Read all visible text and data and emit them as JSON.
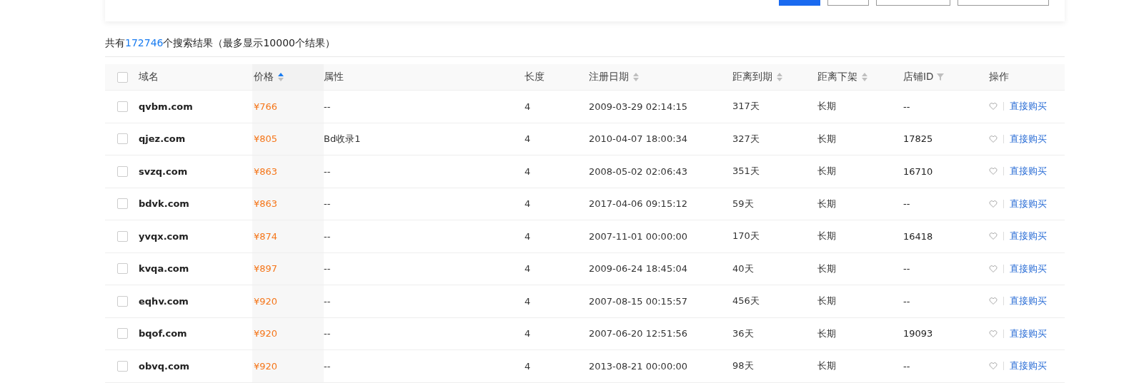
{
  "summary": {
    "before": "共有",
    "count": "172746",
    "after": "个搜索结果（最多显示10000个结果）"
  },
  "table": {
    "select_all_checked": false,
    "columns": [
      {
        "label": "域名",
        "kind": "plain"
      },
      {
        "label": "价格",
        "kind": "sort",
        "sorted_ascending": true
      },
      {
        "label": "属性",
        "kind": "plain"
      },
      {
        "label": "长度",
        "kind": "plain"
      },
      {
        "label": "注册日期",
        "kind": "sort",
        "sorted_ascending": false
      },
      {
        "label": "距离到期",
        "kind": "sort",
        "sorted_ascending": false
      },
      {
        "label": "距离下架",
        "kind": "sort",
        "sorted_ascending": false
      },
      {
        "label": "店铺ID",
        "kind": "filter"
      },
      {
        "label": "操作",
        "kind": "plain"
      }
    ],
    "rows": [
      {
        "checked": false,
        "domain": "qvbm.com",
        "price": "¥766",
        "attribute": "--",
        "length": "4",
        "registered": "2009-03-29 02:14:15",
        "expires_in": "317天",
        "delist_in": "长期",
        "shop_id": "--",
        "action": "直接购买"
      },
      {
        "checked": false,
        "domain": "qjez.com",
        "price": "¥805",
        "attribute": "Bd收录1",
        "length": "4",
        "registered": "2010-04-07 18:00:34",
        "expires_in": "327天",
        "delist_in": "长期",
        "shop_id": "17825",
        "action": "直接购买"
      },
      {
        "checked": false,
        "domain": "svzq.com",
        "price": "¥863",
        "attribute": "--",
        "length": "4",
        "registered": "2008-05-02 02:06:43",
        "expires_in": "351天",
        "delist_in": "长期",
        "shop_id": "16710",
        "action": "直接购买"
      },
      {
        "checked": false,
        "domain": "bdvk.com",
        "price": "¥863",
        "attribute": "--",
        "length": "4",
        "registered": "2017-04-06 09:15:12",
        "expires_in": "59天",
        "delist_in": "长期",
        "shop_id": "--",
        "action": "直接购买"
      },
      {
        "checked": false,
        "domain": "yvqx.com",
        "price": "¥874",
        "attribute": "--",
        "length": "4",
        "registered": "2007-11-01 00:00:00",
        "expires_in": "170天",
        "delist_in": "长期",
        "shop_id": "16418",
        "action": "直接购买"
      },
      {
        "checked": false,
        "domain": "kvqa.com",
        "price": "¥897",
        "attribute": "--",
        "length": "4",
        "registered": "2009-06-24 18:45:04",
        "expires_in": "40天",
        "delist_in": "长期",
        "shop_id": "--",
        "action": "直接购买"
      },
      {
        "checked": false,
        "domain": "eqhv.com",
        "price": "¥920",
        "attribute": "--",
        "length": "4",
        "registered": "2007-08-15 00:15:57",
        "expires_in": "456天",
        "delist_in": "长期",
        "shop_id": "--",
        "action": "直接购买"
      },
      {
        "checked": false,
        "domain": "bqof.com",
        "price": "¥920",
        "attribute": "--",
        "length": "4",
        "registered": "2007-06-20 12:51:56",
        "expires_in": "36天",
        "delist_in": "长期",
        "shop_id": "19093",
        "action": "直接购买"
      },
      {
        "checked": false,
        "domain": "obvq.com",
        "price": "¥920",
        "attribute": "--",
        "length": "4",
        "registered": "2013-08-21 00:00:00",
        "expires_in": "98天",
        "delist_in": "长期",
        "shop_id": "--",
        "action": "直接购买"
      }
    ]
  }
}
